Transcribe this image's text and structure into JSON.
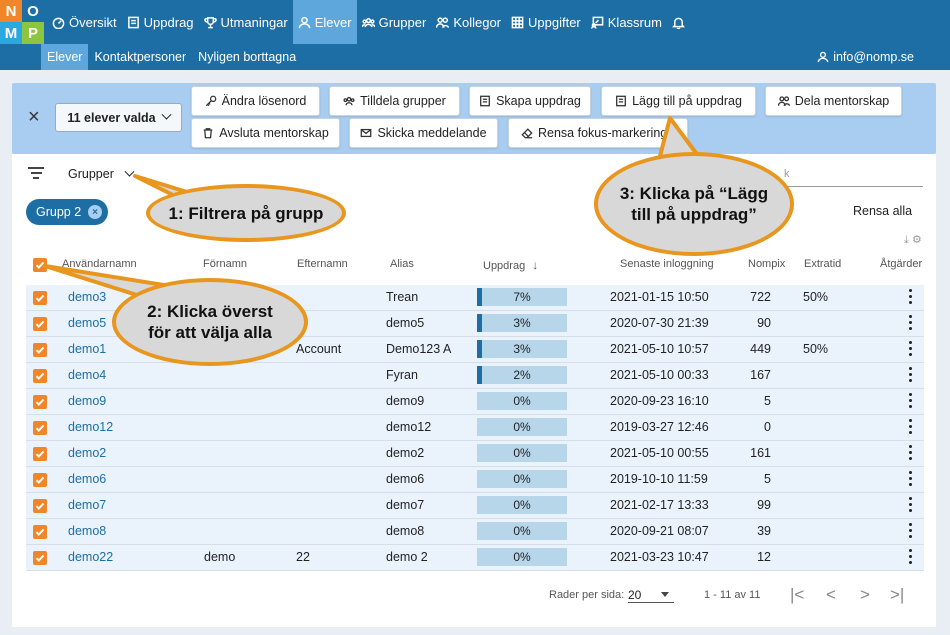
{
  "logo": {
    "letters": [
      "N",
      "O",
      "M",
      "P"
    ],
    "colors": [
      "#f0862a",
      "#1c6ea4",
      "#29a9e0",
      "#8cc63f"
    ]
  },
  "nav": {
    "items": [
      {
        "label": "Översikt",
        "icon": "dashboard-icon"
      },
      {
        "label": "Uppdrag",
        "icon": "book-icon"
      },
      {
        "label": "Utmaningar",
        "icon": "trophy-icon"
      },
      {
        "label": "Elever",
        "icon": "person-icon",
        "active": true
      },
      {
        "label": "Grupper",
        "icon": "group-icon"
      },
      {
        "label": "Kollegor",
        "icon": "colleagues-icon"
      },
      {
        "label": "Uppgifter",
        "icon": "grid-icon"
      },
      {
        "label": "Klassrum",
        "icon": "classroom-icon"
      }
    ],
    "bell_icon": "bell-icon"
  },
  "subnav": {
    "items": [
      "Elever",
      "Kontaktpersoner",
      "Nyligen borttagna"
    ],
    "user_email": "info@nomp.se"
  },
  "actions": {
    "selected_label": "11 elever valda",
    "buttons": [
      {
        "label": "Ändra lösenord",
        "icon": "key-icon"
      },
      {
        "label": "Tilldela grupper",
        "icon": "group-icon"
      },
      {
        "label": "Skapa uppdrag",
        "icon": "book-icon"
      },
      {
        "label": "Lägg till på uppdrag",
        "icon": "book-icon"
      },
      {
        "label": "Dela mentorskap",
        "icon": "colleagues-icon"
      },
      {
        "label": "Avsluta mentorskap",
        "icon": "trash-icon"
      },
      {
        "label": "Skicka meddelande",
        "icon": "mail-icon"
      },
      {
        "label": "Rensa fokus-markeringar",
        "icon": "eraser-icon"
      }
    ]
  },
  "filter": {
    "grupper_label": "Grupper",
    "chip_label": "Grupp 2",
    "clear_all": "Rensa alla",
    "search_fragment": "k"
  },
  "table": {
    "headers": [
      "Användarnamn",
      "Förnamn",
      "Efternamn",
      "Alias",
      "Uppdrag",
      "Senaste inloggning",
      "Nompix",
      "Extratid",
      "Åtgärder"
    ],
    "rows": [
      {
        "user": "demo3",
        "first": "",
        "last": "",
        "alias": "Trean",
        "pct": 7,
        "pct_label": "7%",
        "login": "2021-01-15 10:50",
        "nompix": "722",
        "extra": "50%"
      },
      {
        "user": "demo5",
        "first": "",
        "last": "",
        "alias": "demo5",
        "pct": 3,
        "pct_label": "3%",
        "login": "2020-07-30 21:39",
        "nompix": "90",
        "extra": ""
      },
      {
        "user": "demo1",
        "first": "",
        "last": "Account",
        "alias": "Demo123 A",
        "pct": 3,
        "pct_label": "3%",
        "login": "2021-05-10 10:57",
        "nompix": "449",
        "extra": "50%"
      },
      {
        "user": "demo4",
        "first": "",
        "last": "",
        "alias": "Fyran",
        "pct": 2,
        "pct_label": "2%",
        "login": "2021-05-10 00:33",
        "nompix": "167",
        "extra": ""
      },
      {
        "user": "demo9",
        "first": "",
        "last": "",
        "alias": "demo9",
        "pct": 0,
        "pct_label": "0%",
        "login": "2020-09-23 16:10",
        "nompix": "5",
        "extra": ""
      },
      {
        "user": "demo12",
        "first": "",
        "last": "",
        "alias": "demo12",
        "pct": 0,
        "pct_label": "0%",
        "login": "2019-03-27 12:46",
        "nompix": "0",
        "extra": ""
      },
      {
        "user": "demo2",
        "first": "",
        "last": "",
        "alias": "demo2",
        "pct": 0,
        "pct_label": "0%",
        "login": "2021-05-10 00:55",
        "nompix": "161",
        "extra": ""
      },
      {
        "user": "demo6",
        "first": "",
        "last": "",
        "alias": "demo6",
        "pct": 0,
        "pct_label": "0%",
        "login": "2019-10-10 11:59",
        "nompix": "5",
        "extra": ""
      },
      {
        "user": "demo7",
        "first": "",
        "last": "",
        "alias": "demo7",
        "pct": 0,
        "pct_label": "0%",
        "login": "2021-02-17 13:33",
        "nompix": "99",
        "extra": ""
      },
      {
        "user": "demo8",
        "first": "",
        "last": "",
        "alias": "demo8",
        "pct": 0,
        "pct_label": "0%",
        "login": "2020-09-21 08:07",
        "nompix": "39",
        "extra": ""
      },
      {
        "user": "demo22",
        "first": "demo",
        "last": "22",
        "alias": "demo 2",
        "pct": 0,
        "pct_label": "0%",
        "login": "2021-03-23 10:47",
        "nompix": "12",
        "extra": ""
      }
    ]
  },
  "footer": {
    "rows_label": "Rader per sida:",
    "rows_value": "20",
    "range": "1 - 11 av 11"
  },
  "callouts": {
    "c1": "1: Filtrera på grupp",
    "c2_line1": "2: Klicka överst",
    "c2_line2": "för att välja alla",
    "c3_line1": "3: Klicka på “Lägg",
    "c3_line2": "till på uppdrag”"
  },
  "colors": {
    "primary": "#1c6ea4",
    "active": "#5ea7dd",
    "checkbox": "#f0862a",
    "callout_border": "#e8961e"
  }
}
